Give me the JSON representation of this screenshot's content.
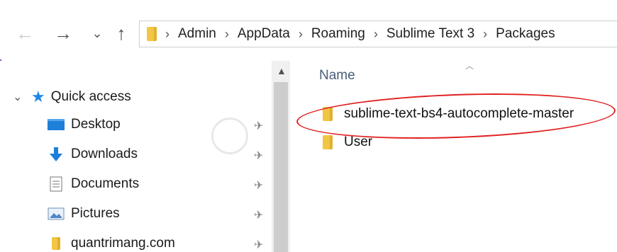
{
  "nav": {
    "back_icon": "←",
    "forward_icon": "→",
    "recent_icon": "⌄",
    "up_icon": "↑"
  },
  "breadcrumb": [
    "Admin",
    "AppData",
    "Roaming",
    "Sublime Text 3",
    "Packages"
  ],
  "sidebar": {
    "quick_access": "Quick access",
    "items": [
      {
        "label": "Desktop",
        "icon": "desktop-icon"
      },
      {
        "label": "Downloads",
        "icon": "download-icon"
      },
      {
        "label": "Documents",
        "icon": "documents-icon"
      },
      {
        "label": "Pictures",
        "icon": "pictures-icon"
      },
      {
        "label": "quantrimang.com",
        "icon": "folder-icon"
      }
    ]
  },
  "content": {
    "column_name": "Name",
    "files": [
      "sublime-text-bs4-autocomplete-master",
      "User"
    ]
  },
  "colors": {
    "highlight": "#e02020",
    "folder": "#f0c644",
    "quick_access_star": "#1e88e5"
  }
}
